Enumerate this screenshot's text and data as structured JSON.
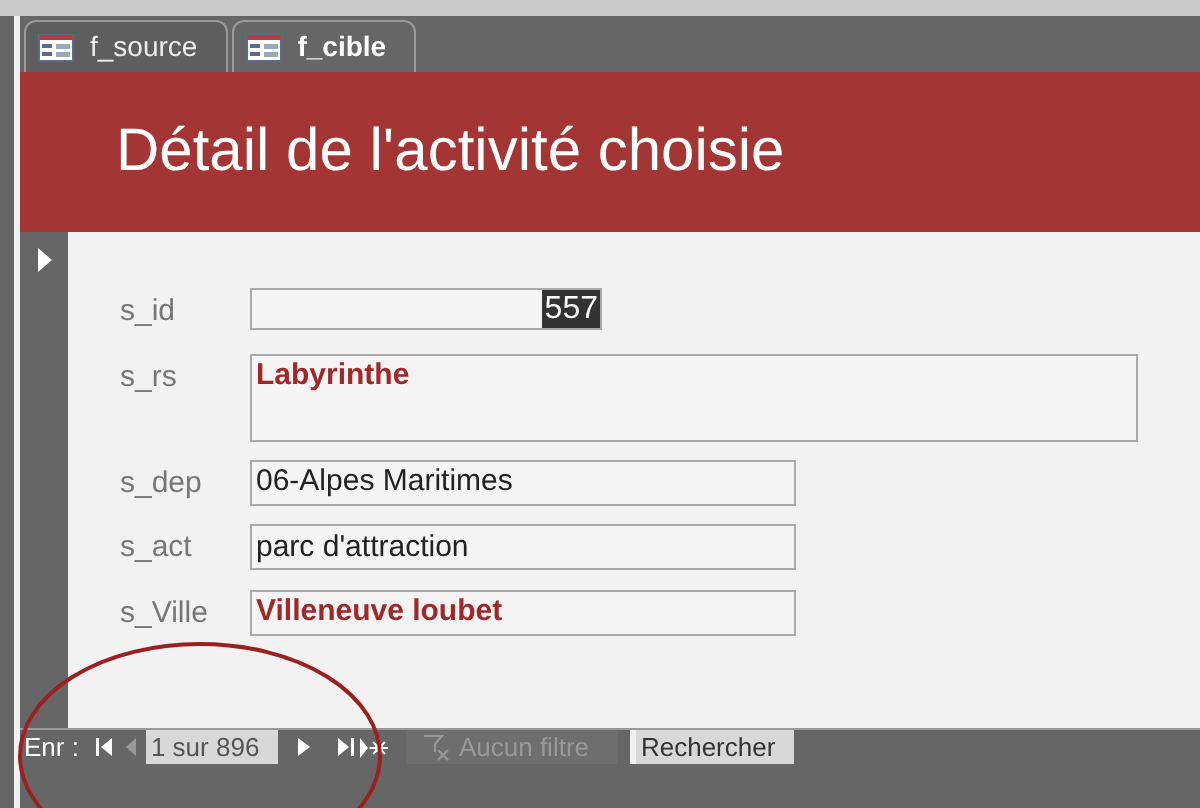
{
  "tabs": [
    {
      "label": "f_source",
      "selected": false
    },
    {
      "label": "f_cible",
      "selected": true
    }
  ],
  "header": {
    "title": "Détail de l'activité choisie"
  },
  "fields": [
    {
      "label": "s_id",
      "value": "557",
      "kind": "number",
      "emphasized": false,
      "selected": true
    },
    {
      "label": "s_rs",
      "value": "Labyrinthe",
      "kind": "memo",
      "emphasized": true,
      "selected": false
    },
    {
      "label": "s_dep",
      "value": "06-Alpes Maritimes",
      "kind": "text",
      "emphasized": false,
      "selected": false
    },
    {
      "label": "s_act",
      "value": "parc d'attraction",
      "kind": "text",
      "emphasized": false,
      "selected": false
    },
    {
      "label": "s_Ville",
      "value": "Villeneuve loubet",
      "kind": "text",
      "emphasized": true,
      "selected": false
    }
  ],
  "navigation": {
    "label": "Enr :",
    "position": "1 sur 896",
    "filter": {
      "label": "Aucun filtre",
      "disabled": true
    },
    "search": {
      "placeholder": "Rechercher"
    }
  }
}
